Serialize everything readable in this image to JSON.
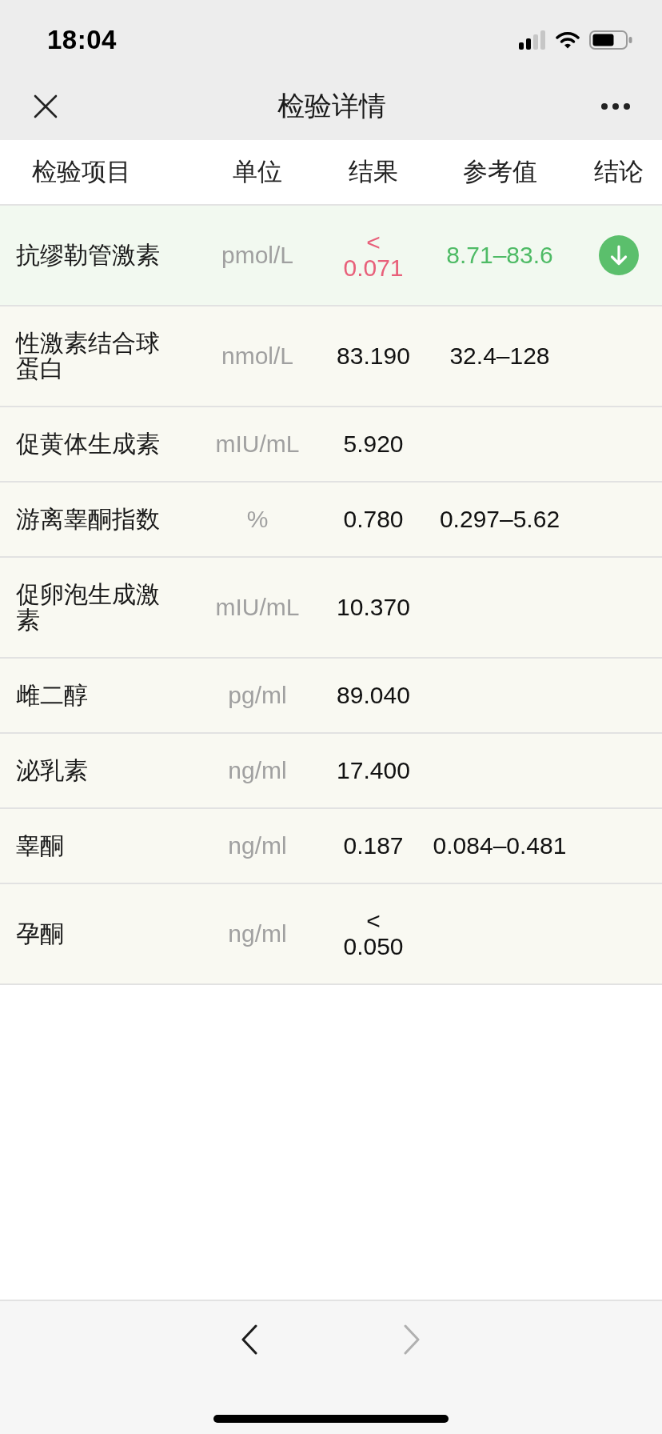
{
  "status_bar": {
    "time": "18:04"
  },
  "nav_bar": {
    "title": "检验详情"
  },
  "table": {
    "columns": [
      "检验项目",
      "单位",
      "结果",
      "参考值",
      "结论"
    ],
    "rows": [
      {
        "item": "抗缪勒管激素",
        "unit": "pmol/L",
        "result": "< 0.071",
        "reference": "8.71–83.6",
        "below_range": true
      },
      {
        "item": "性激素结合球蛋白",
        "unit": "nmol/L",
        "result": "83.190",
        "reference": "32.4–128",
        "below_range": false
      },
      {
        "item": "促黄体生成素",
        "unit": "mIU/mL",
        "result": "5.920",
        "below_range": false
      },
      {
        "item": "游离睾酮指数",
        "unit": "%",
        "result": "0.780",
        "reference": "0.297–5.62",
        "below_range": false
      },
      {
        "item": "促卵泡生成激素",
        "unit": "mIU/mL",
        "result": "10.370",
        "below_range": false
      },
      {
        "item": "雌二醇",
        "unit": "pg/ml",
        "result": "89.040",
        "below_range": false
      },
      {
        "item": "泌乳素",
        "unit": "ng/ml",
        "result": "17.400",
        "below_range": false
      },
      {
        "item": "睾酮",
        "unit": "ng/ml",
        "result": "0.187",
        "reference": "0.084–0.481",
        "below_range": false
      },
      {
        "item": "孕酮",
        "unit": "ng/ml",
        "result": "< 0.050",
        "below_range": false
      }
    ]
  },
  "toolbar": {
    "back": {
      "disabled": false
    },
    "forward": {
      "disabled": true
    }
  }
}
